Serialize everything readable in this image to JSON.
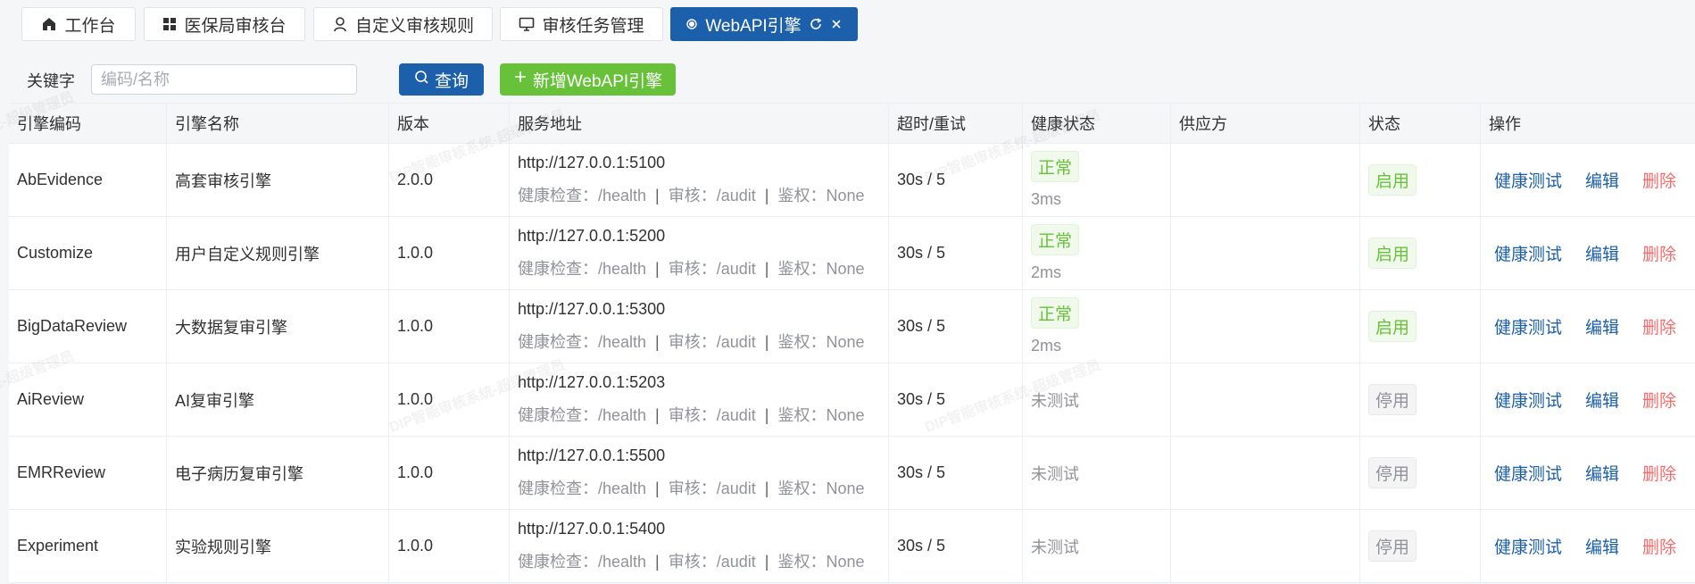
{
  "tabs": [
    {
      "label": "工作台",
      "icon": "home-icon",
      "active": false
    },
    {
      "label": "医保局审核台",
      "icon": "grid-icon",
      "active": false
    },
    {
      "label": "自定义审核规则",
      "icon": "user-icon",
      "active": false
    },
    {
      "label": "审核任务管理",
      "icon": "monitor-icon",
      "active": false
    },
    {
      "label": "WebAPI引擎",
      "icon": "dot-icon",
      "active": true
    }
  ],
  "filter": {
    "keyword_label": "关键字",
    "keyword_placeholder": "编码/名称",
    "keyword_value": "",
    "query_label": "查询",
    "add_label": "新增WebAPI引擎"
  },
  "table": {
    "columns": [
      "引擎编码",
      "引擎名称",
      "版本",
      "服务地址",
      "超时/重试",
      "健康状态",
      "供应方",
      "状态",
      "操作"
    ],
    "rows": [
      {
        "code": "AbEvidence",
        "name": "高套审核引擎",
        "version": "2.0.0",
        "url": "http://127.0.0.1:5100",
        "health_path": "健康检查：/health",
        "audit_path": "审核：/audit",
        "auth": "鉴权：None",
        "timeout": "30s / 5",
        "health": "正常",
        "latency": "3ms",
        "vendor": "",
        "status": "启用"
      },
      {
        "code": "Customize",
        "name": "用户自定义规则引擎",
        "version": "1.0.0",
        "url": "http://127.0.0.1:5200",
        "health_path": "健康检查：/health",
        "audit_path": "审核：/audit",
        "auth": "鉴权：None",
        "timeout": "30s / 5",
        "health": "正常",
        "latency": "2ms",
        "vendor": "",
        "status": "启用"
      },
      {
        "code": "BigDataReview",
        "name": "大数据复审引擎",
        "version": "1.0.0",
        "url": "http://127.0.0.1:5300",
        "health_path": "健康检查：/health",
        "audit_path": "审核：/audit",
        "auth": "鉴权：None",
        "timeout": "30s / 5",
        "health": "正常",
        "latency": "2ms",
        "vendor": "",
        "status": "启用"
      },
      {
        "code": "AiReview",
        "name": "AI复审引擎",
        "version": "1.0.0",
        "url": "http://127.0.0.1:5203",
        "health_path": "健康检查：/health",
        "audit_path": "审核：/audit",
        "auth": "鉴权：None",
        "timeout": "30s / 5",
        "health": "未测试",
        "latency": "",
        "vendor": "",
        "status": "停用"
      },
      {
        "code": "EMRReview",
        "name": "电子病历复审引擎",
        "version": "1.0.0",
        "url": "http://127.0.0.1:5500",
        "health_path": "健康检查：/health",
        "audit_path": "审核：/audit",
        "auth": "鉴权：None",
        "timeout": "30s / 5",
        "health": "未测试",
        "latency": "",
        "vendor": "",
        "status": "停用"
      },
      {
        "code": "Experiment",
        "name": "实验规则引擎",
        "version": "1.0.0",
        "url": "http://127.0.0.1:5400",
        "health_path": "健康检查：/health",
        "audit_path": "审核：/audit",
        "auth": "鉴权：None",
        "timeout": "30s / 5",
        "health": "未测试",
        "latency": "",
        "vendor": "",
        "status": "停用"
      }
    ],
    "actions": {
      "test": "健康测试",
      "edit": "编辑",
      "delete": "删除"
    }
  },
  "watermark": "DIP智能审核系统-超级管理员",
  "colors": {
    "primary": "#1c5fab",
    "success": "#67c23a",
    "danger": "#f56c6c",
    "muted": "#909399"
  }
}
